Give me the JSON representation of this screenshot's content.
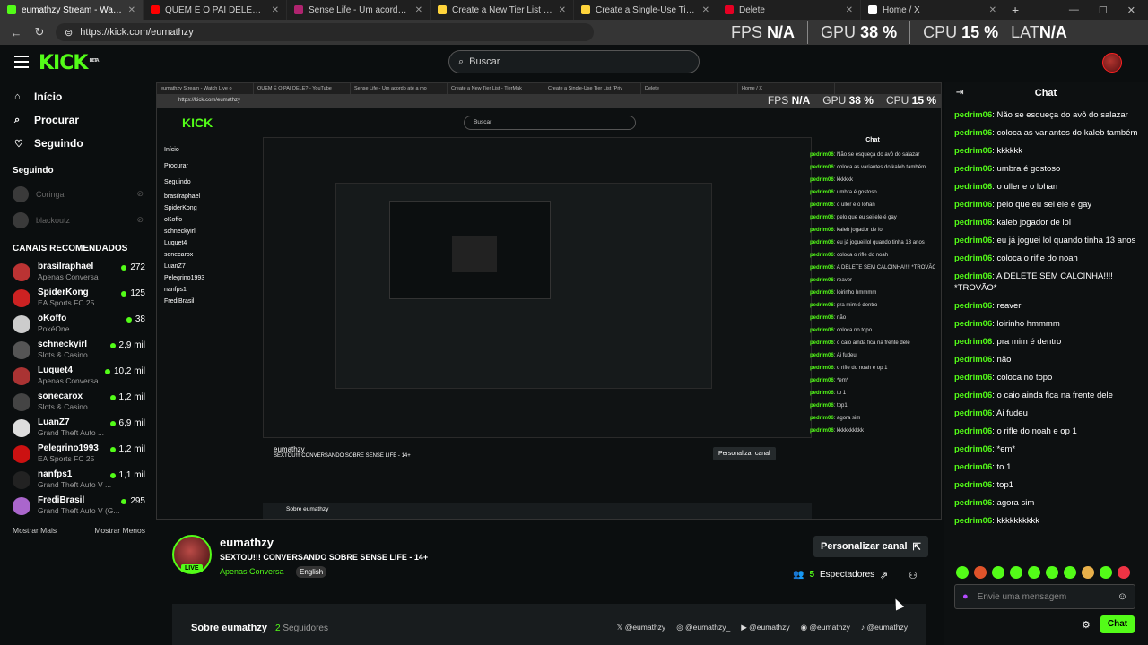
{
  "browser": {
    "tabs": [
      {
        "title": "eumathzy Stream - Watch Live o",
        "color": "#53fc18",
        "active": true
      },
      {
        "title": "QUEM É O PAI DELE? - YouTube",
        "color": "#ff0000"
      },
      {
        "title": "Sense Life - Um acordo até a mo",
        "color": "#b0246f"
      },
      {
        "title": "Create a New Tier List - TierMak",
        "color": "#ffd43b"
      },
      {
        "title": "Create a Single-Use Tier List (Priv",
        "color": "#ffd43b"
      },
      {
        "title": "Delete",
        "color": "#e60023"
      },
      {
        "title": "Home / X",
        "color": "#ffffff"
      }
    ],
    "url": "https://kick.com/eumathzy",
    "overlay": {
      "fps_label": "FPS",
      "fps_value": "N/A",
      "gpu_label": "GPU",
      "gpu_value": "38 %",
      "cpu_label": "CPU",
      "cpu_value": "15 %",
      "lat_label": "LAT",
      "lat_value": "N/A"
    }
  },
  "header": {
    "logo": "KICK",
    "logo_beta": "BETA",
    "search_placeholder": "Buscar"
  },
  "sidebar": {
    "nav": [
      {
        "label": "Início",
        "icon": "home-icon"
      },
      {
        "label": "Procurar",
        "icon": "compass-icon"
      },
      {
        "label": "Seguindo",
        "icon": "heart-icon"
      }
    ],
    "following_heading": "Seguindo",
    "following": [
      {
        "name": "Coringa"
      },
      {
        "name": "blackoutz"
      }
    ],
    "recommended_heading": "CANAIS RECOMENDADOS",
    "recommended": [
      {
        "name": "brasilraphael",
        "category": "Apenas Conversa",
        "viewers": "272",
        "color": "#b33"
      },
      {
        "name": "SpiderKong",
        "category": "EA Sports FC 25",
        "viewers": "125",
        "color": "#c22"
      },
      {
        "name": "oKoffo",
        "category": "PokéOne",
        "viewers": "38",
        "color": "#ccc"
      },
      {
        "name": "schneckyirl",
        "category": "Slots & Casino",
        "viewers": "2,9 mil",
        "color": "#555"
      },
      {
        "name": "Luquet4",
        "category": "Apenas Conversa",
        "viewers": "10,2 mil",
        "color": "#a33"
      },
      {
        "name": "sonecarox",
        "category": "Slots & Casino",
        "viewers": "1,2 mil",
        "color": "#444"
      },
      {
        "name": "LuanZ7",
        "category": "Grand Theft Auto ...",
        "viewers": "6,9 mil",
        "color": "#ddd"
      },
      {
        "name": "Pelegrino1993",
        "category": "EA Sports FC 25",
        "viewers": "1,2 mil",
        "color": "#c11"
      },
      {
        "name": "nanfps1",
        "category": "Grand Theft Auto V ...",
        "viewers": "1,1 mil",
        "color": "#222"
      },
      {
        "name": "FrediBrasil",
        "category": "Grand Theft Auto V (G...",
        "viewers": "295",
        "color": "#a6c"
      }
    ],
    "show_more": "Mostrar Mais",
    "show_less": "Mostrar Menos"
  },
  "stream": {
    "streamer": "eumathzy",
    "live": "LIVE",
    "title": "SEXTOU!!! CONVERSANDO SOBRE SENSE LIFE - 14+",
    "category": "Apenas Conversa",
    "language": "English",
    "customize_button": "Personalizar canal",
    "viewers_count": "5",
    "viewers_label": "Espectadores",
    "about_label": "Sobre eumathzy",
    "followers_count": "2",
    "followers_label": "Seguidores",
    "socials": [
      "@eumathzy",
      "@eumathzy_",
      "@eumathzy",
      "@eumathzy",
      "@eumathzy"
    ]
  },
  "chat": {
    "title": "Chat",
    "messages": [
      {
        "user": "pedrim06",
        "text": "Não se esqueça do avô do salazar"
      },
      {
        "user": "pedrim06",
        "text": "coloca as variantes do kaleb também"
      },
      {
        "user": "pedrim06",
        "text": "kkkkkk"
      },
      {
        "user": "pedrim06",
        "text": "umbra é gostoso"
      },
      {
        "user": "pedrim06",
        "text": "o uller e o lohan"
      },
      {
        "user": "pedrim06",
        "text": "pelo que eu sei ele é gay"
      },
      {
        "user": "pedrim06",
        "text": "kaleb jogador de lol"
      },
      {
        "user": "pedrim06",
        "text": "eu já joguei lol quando tinha 13 anos"
      },
      {
        "user": "pedrim06",
        "text": "coloca o rifle do noah"
      },
      {
        "user": "pedrim06",
        "text": "A DELETE SEM CALCINHA!!!! *TROVÃO*"
      },
      {
        "user": "pedrim06",
        "text": "reaver"
      },
      {
        "user": "pedrim06",
        "text": "loirinho hmmmm"
      },
      {
        "user": "pedrim06",
        "text": "pra mim é dentro"
      },
      {
        "user": "pedrim06",
        "text": "não"
      },
      {
        "user": "pedrim06",
        "text": "coloca no topo"
      },
      {
        "user": "pedrim06",
        "text": "o caio ainda fica na frente dele"
      },
      {
        "user": "pedrim06",
        "text": "Ai fudeu"
      },
      {
        "user": "pedrim06",
        "text": "o rifle do noah e op 1"
      },
      {
        "user": "pedrim06",
        "text": "*em*"
      },
      {
        "user": "pedrim06",
        "text": "to 1"
      },
      {
        "user": "pedrim06",
        "text": "top1"
      },
      {
        "user": "pedrim06",
        "text": "agora sim"
      },
      {
        "user": "pedrim06",
        "text": "kkkkkkkkkk"
      }
    ],
    "input_placeholder": "Envie uma mensagem",
    "send_button": "Chat"
  }
}
